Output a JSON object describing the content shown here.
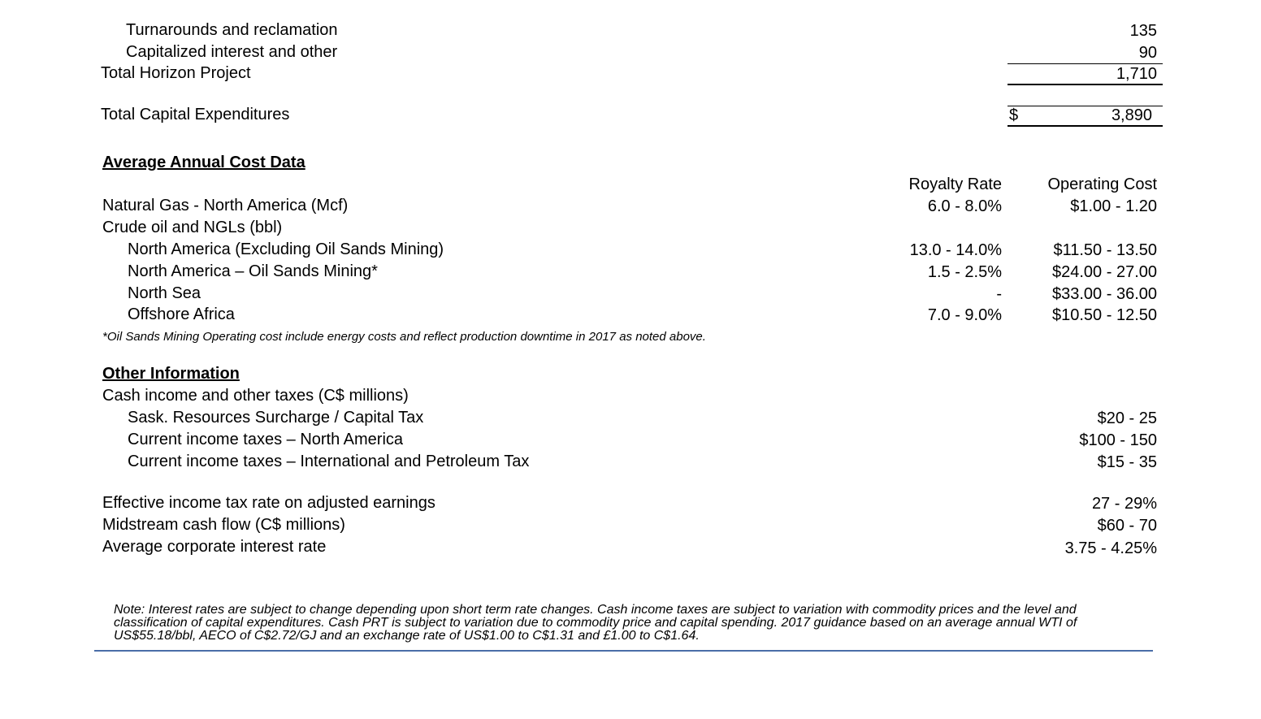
{
  "capex": {
    "rows": [
      {
        "label": "Turnarounds and reclamation",
        "value": "135"
      },
      {
        "label": "Capitalized interest and other",
        "value": "90"
      }
    ],
    "total_horizon": {
      "label": "Total Horizon Project",
      "value": "1,710"
    },
    "total_capex": {
      "label": "Total Capital Expenditures",
      "currency": "$",
      "value": "3,890"
    }
  },
  "cost_data": {
    "heading": "Average Annual Cost Data",
    "col_royalty": "Royalty Rate",
    "col_opcost": "Operating Cost",
    "rows": [
      {
        "label": "Natural Gas - North America (Mcf)",
        "royalty": "6.0 - 8.0%",
        "opcost": "$1.00 - 1.20"
      },
      {
        "label": "Crude oil and NGLs (bbl)",
        "royalty": "",
        "opcost": ""
      },
      {
        "label": "North America (Excluding Oil Sands Mining)",
        "royalty": "13.0 - 14.0%",
        "opcost": "$11.50 - 13.50"
      },
      {
        "label": "North America – Oil Sands Mining*",
        "royalty": "1.5 - 2.5%",
        "opcost": "$24.00 - 27.00"
      },
      {
        "label": "North Sea",
        "royalty": "-",
        "opcost": "$33.00 - 36.00"
      },
      {
        "label": "Offshore Africa",
        "royalty": "7.0 - 9.0%",
        "opcost": "$10.50 - 12.50"
      }
    ],
    "footnote": "*Oil Sands Mining Operating cost include energy costs and reflect production downtime in 2017 as noted above."
  },
  "other_info": {
    "heading": "Other Information",
    "rows": [
      {
        "label": "Cash income and other taxes (C$ millions)",
        "value": ""
      },
      {
        "label": "Sask. Resources Surcharge / Capital Tax",
        "value": "$20 - 25"
      },
      {
        "label": "Current income taxes – North America",
        "value": "$100 - 150"
      },
      {
        "label": "Current income taxes – International and Petroleum Tax",
        "value": "$15 - 35"
      },
      {
        "label": "Effective income tax rate on adjusted earnings",
        "value": "27 - 29%"
      },
      {
        "label": "Midstream cash flow (C$ millions)",
        "value": "$60 - 70"
      },
      {
        "label": "Average corporate interest rate",
        "value": "3.75 - 4.25%"
      }
    ]
  },
  "note": "Note: Interest rates are subject to change depending upon short term rate changes. Cash income taxes are subject to variation with commodity prices and the level and classification of capital expenditures. Cash PRT is subject to variation due to commodity price and capital spending. 2017 guidance based on an average annual WTI of US$55.18/bbl, AECO of C$2.72/GJ and an exchange rate of US$1.00 to C$1.31 and £1.00 to C$1.64.",
  "colors": {
    "rule": "#000000",
    "bottom_rule": "#4a6ea8"
  }
}
